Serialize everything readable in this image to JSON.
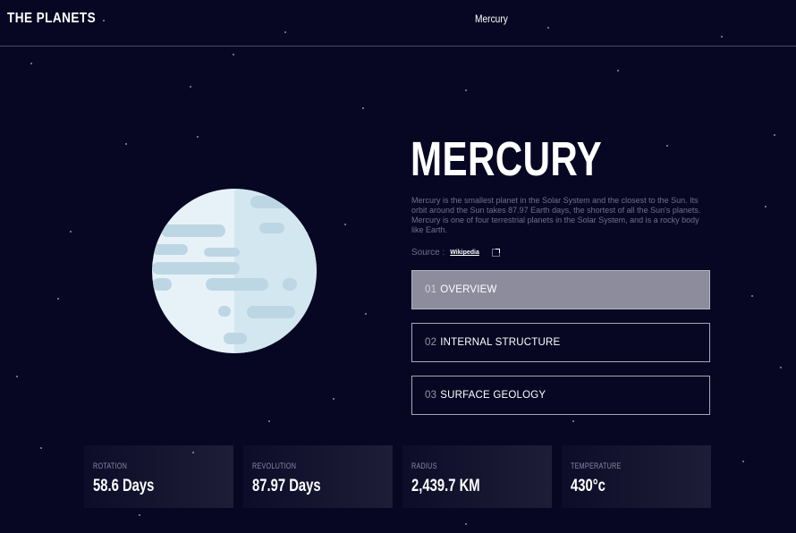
{
  "header": {
    "logo": "THE PLANETS",
    "nav": [
      "Mercury"
    ]
  },
  "planet": {
    "name": "MERCURY",
    "description": "Mercury is the smallest planet in the Solar System and the closest to the Sun. Its orbit around the Sun takes 87.97 Earth days, the shortest of all the Sun's planets. Mercury is one of four terrestrial planets in the Solar System, and is a rocky body like Earth.",
    "source_label": "Source :",
    "source_link": "Wikipedia",
    "source_icon": "external-link-icon"
  },
  "tabs": [
    {
      "num": "01",
      "label": "OVERVIEW",
      "active": true
    },
    {
      "num": "02",
      "label": "INTERNAL STRUCTURE",
      "active": false
    },
    {
      "num": "03",
      "label": "SURFACE GEOLOGY",
      "active": false
    }
  ],
  "stats": [
    {
      "label": "Rotation",
      "value": "58.6 Days"
    },
    {
      "label": "Revolution",
      "value": "87.97 Days"
    },
    {
      "label": "Radius",
      "value": "2,439.7 KM"
    },
    {
      "label": "Temperature",
      "value": "430°c"
    }
  ],
  "colors": {
    "background": "#070724",
    "active_tab": "#8c8c9d",
    "planet_light": "#e7f2f8",
    "planet_shade": "#b9d5e2"
  }
}
